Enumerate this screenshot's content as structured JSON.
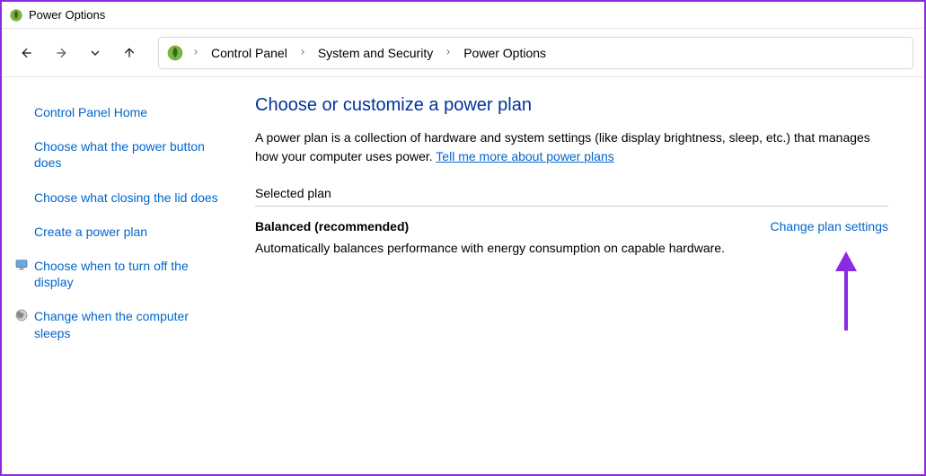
{
  "titlebar": {
    "title": "Power Options"
  },
  "breadcrumb": {
    "item0": "Control Panel",
    "item1": "System and Security",
    "item2": "Power Options"
  },
  "sidebar": {
    "home": "Control Panel Home",
    "item0": "Choose what the power button does",
    "item1": "Choose what closing the lid does",
    "item2": "Create a power plan",
    "item3": "Choose when to turn off the display",
    "item4": "Change when the computer sleeps"
  },
  "main": {
    "heading": "Choose or customize a power plan",
    "desc_text": "A power plan is a collection of hardware and system settings (like display brightness, sleep, etc.) that manages how your computer uses power. ",
    "desc_link": "Tell me more about power plans",
    "section_header": "Selected plan",
    "plan_name": "Balanced (recommended)",
    "plan_desc": "Automatically balances performance with energy consumption on capable hardware.",
    "change_link": "Change plan settings"
  }
}
